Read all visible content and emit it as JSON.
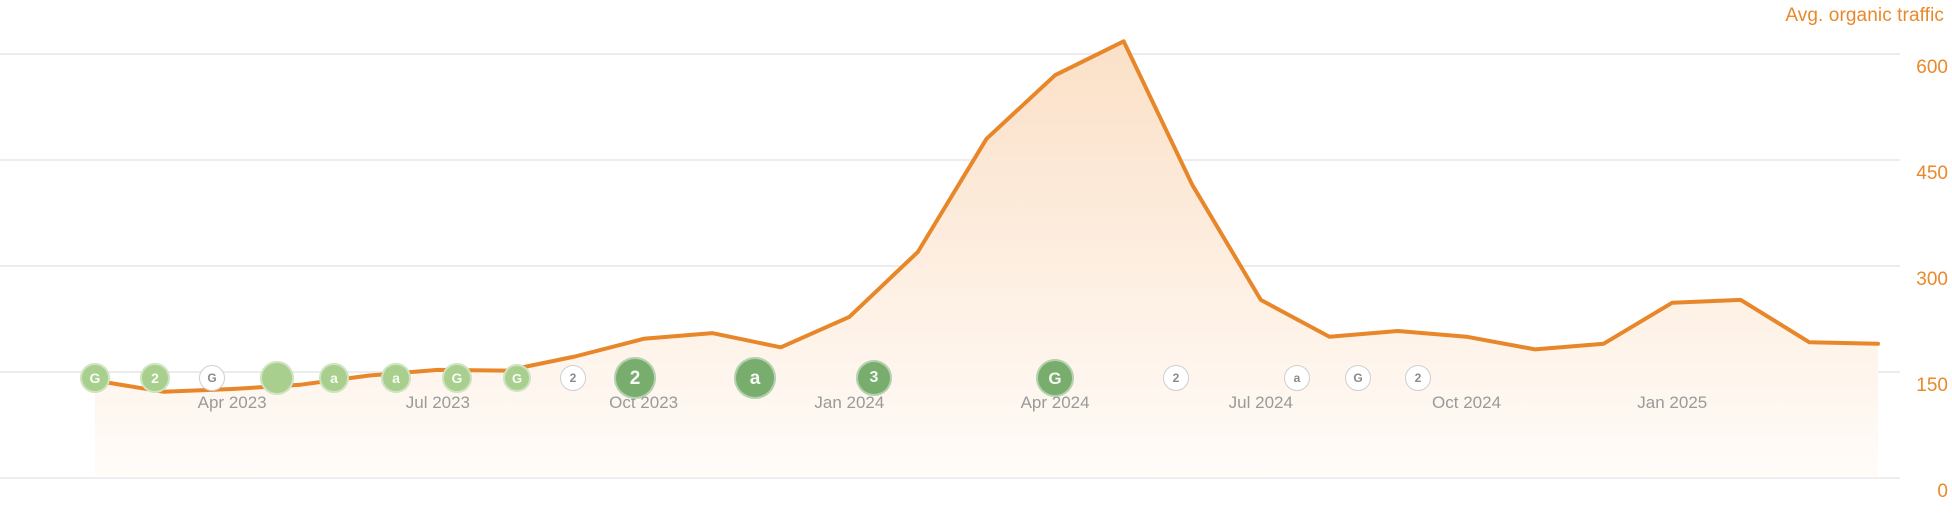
{
  "header": {
    "title": "Avg. organic traffic",
    "title_color": "#e8892b"
  },
  "axis": {
    "y_ticks": [
      "600",
      "450",
      "300",
      "150",
      "0"
    ],
    "x_ticks": [
      "Apr 2023",
      "Jul 2023",
      "Oct 2023",
      "Jan 2024",
      "Apr 2024",
      "Jul 2024",
      "Oct 2024",
      "Jan 2025"
    ]
  },
  "colors": {
    "line": "#e8862a",
    "area_top": "#fbe2cc",
    "area_bottom": "#fffdfb",
    "grid": "#ececec",
    "tick_text": "#9a9a9a",
    "marker_light": "#a8cf8e",
    "marker_dark": "#78ad6e",
    "marker_hollow_border": "#cfcfcf",
    "marker_hollow_text": "#8a8a8a"
  },
  "chart_data": {
    "type": "area",
    "title": "Avg. organic traffic",
    "xlabel": "",
    "ylabel": "Avg. organic traffic",
    "ylim": [
      0,
      660
    ],
    "grid": true,
    "legend": "none",
    "x": [
      "Feb 2023",
      "Mar 2023",
      "Apr 2023",
      "May 2023",
      "Jun 2023",
      "Jul 2023",
      "Aug 2023",
      "Sep 2023",
      "Oct 2023",
      "Nov 2023",
      "Dec 2023",
      "Jan 2024",
      "Feb 2024",
      "Mar 2024",
      "Apr 2024",
      "May 2024",
      "Jun 2024",
      "Jul 2024",
      "Aug 2024",
      "Sep 2024",
      "Oct 2024",
      "Nov 2024",
      "Dec 2024",
      "Jan 2025"
    ],
    "values": [
      138,
      122,
      126,
      132,
      145,
      153,
      152,
      170,
      197,
      205,
      185,
      210,
      260,
      420,
      575,
      615,
      470,
      275,
      215,
      222,
      205,
      190,
      200,
      255,
      262,
      195,
      192
    ],
    "series": [
      {
        "name": "Avg. organic traffic",
        "points": [
          {
            "x": "Feb 2023",
            "y": 138
          },
          {
            "x": "Mar 2023",
            "y": 122
          },
          {
            "x": "Apr 2023",
            "y": 126
          },
          {
            "x": "May 2023",
            "y": 132
          },
          {
            "x": "Jun 2023",
            "y": 145
          },
          {
            "x": "Jul 2023",
            "y": 153
          },
          {
            "x": "Aug 2023",
            "y": 152
          },
          {
            "x": "Sep 2023",
            "y": 172
          },
          {
            "x": "Oct 2023",
            "y": 197
          },
          {
            "x": "Nov 2023",
            "y": 205
          },
          {
            "x": "Dec 2023",
            "y": 185
          },
          {
            "x": "Jan 2024",
            "y": 228
          },
          {
            "x": "Feb 2024",
            "y": 320
          },
          {
            "x": "Mar 2024",
            "y": 480
          },
          {
            "x": "Apr 2024",
            "y": 570
          },
          {
            "x": "May 2024",
            "y": 618
          },
          {
            "x": "Jun 2024",
            "y": 415
          },
          {
            "x": "Jul 2024",
            "y": 252
          },
          {
            "x": "Aug 2024",
            "y": 200
          },
          {
            "x": "Sep 2024",
            "y": 208
          },
          {
            "x": "Oct 2024",
            "y": 200
          },
          {
            "x": "Nov 2024",
            "y": 182
          },
          {
            "x": "Dec 2024",
            "y": 190
          },
          {
            "x": "Jan 2025",
            "y": 248
          },
          {
            "x": "Feb 2025",
            "y": 252
          },
          {
            "x": "Mar 2025",
            "y": 192
          },
          {
            "x": "Apr 2025",
            "y": 190
          }
        ]
      }
    ]
  },
  "markers": [
    {
      "label": "G",
      "style": "solid-light",
      "size": 30
    },
    {
      "label": "2",
      "style": "solid-light",
      "size": 30
    },
    {
      "label": "G",
      "style": "hollow",
      "size": 26
    },
    {
      "label": "",
      "style": "solid-light",
      "size": 34
    },
    {
      "label": "a",
      "style": "solid-light",
      "size": 30
    },
    {
      "label": "a",
      "style": "solid-light",
      "size": 30
    },
    {
      "label": "G",
      "style": "solid-light",
      "size": 30
    },
    {
      "label": "G",
      "style": "solid-light",
      "size": 28
    },
    {
      "label": "2",
      "style": "hollow",
      "size": 26
    },
    {
      "label": "2",
      "style": "solid-dark",
      "size": 42
    },
    {
      "label": "a",
      "style": "solid-dark",
      "size": 42
    },
    {
      "label": "3",
      "style": "solid-dark",
      "size": 36
    },
    {
      "label": "G",
      "style": "solid-dark",
      "size": 38
    },
    {
      "label": "2",
      "style": "hollow",
      "size": 26
    },
    {
      "label": "a",
      "style": "hollow",
      "size": 26
    },
    {
      "label": "G",
      "style": "hollow",
      "size": 26
    },
    {
      "label": "2",
      "style": "hollow",
      "size": 26
    }
  ]
}
